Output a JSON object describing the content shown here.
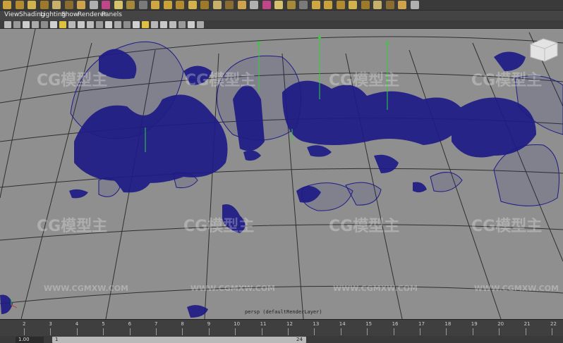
{
  "menubar": {
    "items": [
      "View",
      "Shading",
      "Lighting",
      "Show",
      "Renderer",
      "Panels"
    ]
  },
  "viewport": {
    "camera_label": "persp (defaultRenderLayer)",
    "background_color": "#8f8f8f",
    "wireframe_color": "#1e1b86",
    "grid_color": "#2f2f2f"
  },
  "watermarks": {
    "logo_text": "CG模型主",
    "url_text": "WWW.CGMXW.COM"
  },
  "timeline": {
    "ticks": [
      "2",
      "3",
      "4",
      "5",
      "6",
      "7",
      "8",
      "9",
      "10",
      "11",
      "12",
      "13",
      "14",
      "15",
      "16",
      "17",
      "18",
      "19",
      "20",
      "21",
      "22"
    ]
  },
  "range_slider": {
    "current_frame": "1.00",
    "start": "1",
    "end": "24"
  },
  "icons": {
    "view_cube": "view-cube-icon",
    "axis_gizmo": "axis-gizmo-icon"
  }
}
